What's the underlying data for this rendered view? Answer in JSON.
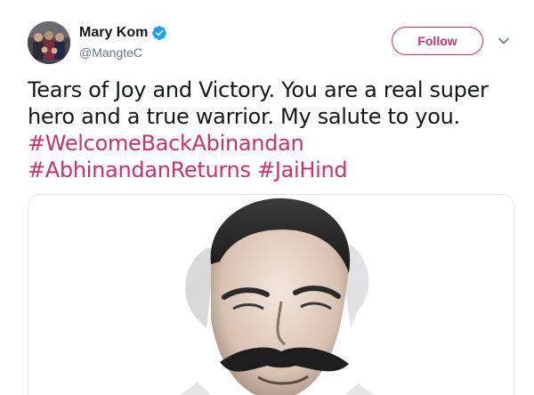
{
  "author": {
    "display_name": "Mary Kom",
    "handle": "@MangteC",
    "verified": true
  },
  "actions": {
    "follow_label": "Follow"
  },
  "tweet": {
    "line1": "Tears of Joy and Victory. You are a real super",
    "line2": "hero and a true warrior. My salute to you.",
    "hashtags": [
      "#WelcomeBackAbinandan",
      "#AbhinandanReturns",
      "#JaiHind"
    ]
  },
  "icons": {
    "verified": "verified-badge-icon",
    "caret": "chevron-down-icon"
  },
  "colors": {
    "accent": "#c8336a",
    "verified": "#1da1f2",
    "secondary_text": "#657786"
  }
}
